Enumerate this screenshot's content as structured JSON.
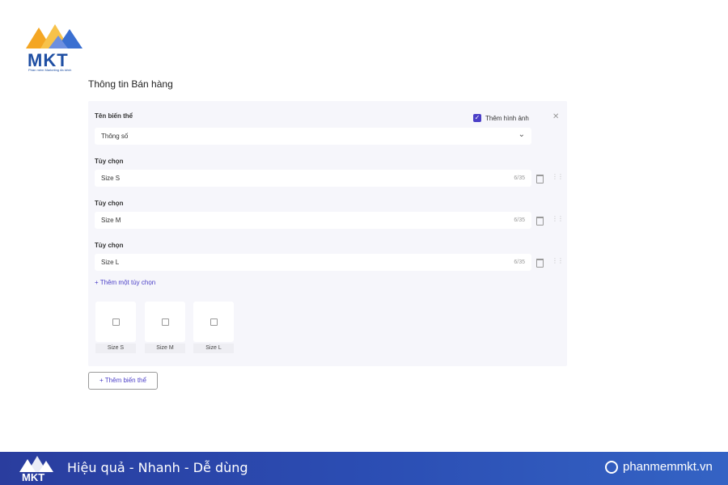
{
  "logo": {
    "brand": "MKT",
    "tagline": "Phần mềm Marketing đa kênh"
  },
  "section_title": "Thông tin Bán hàng",
  "variant": {
    "name_label": "Tên biến thể",
    "name_value": "Thông số",
    "add_image_label": "Thêm hình ảnh",
    "add_image_checked": true,
    "options": [
      {
        "label": "Tùy chọn",
        "value": "Size S",
        "count": "6/35"
      },
      {
        "label": "Tùy chọn",
        "value": "Size M",
        "count": "6/35"
      },
      {
        "label": "Tùy chọn",
        "value": "Size L",
        "count": "6/35"
      }
    ],
    "add_option_label": "+ Thêm một tùy chọn",
    "thumbnails": [
      "Size S",
      "Size M",
      "Size L"
    ]
  },
  "add_variant_label": "+ Thêm biến thể",
  "footer": {
    "brand": "MKT",
    "slogan": "Hiệu quả - Nhanh - Dễ dùng",
    "site": "phanmemmkt.vn"
  },
  "colors": {
    "accent": "#4b3fc7",
    "brand_blue": "#1f4fa3",
    "footer_bg": "#2b4db3"
  }
}
